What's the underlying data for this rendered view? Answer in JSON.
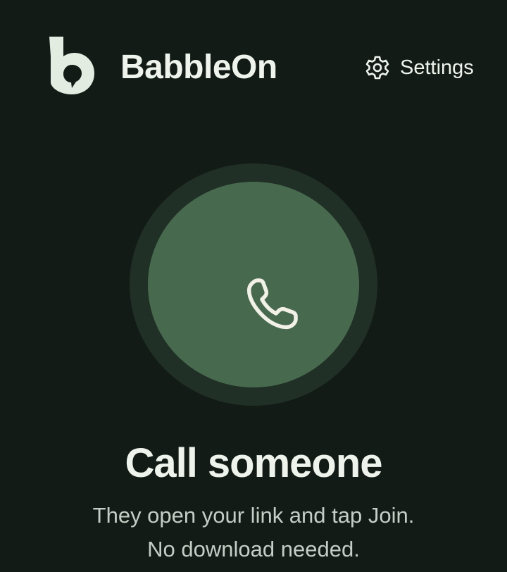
{
  "app": {
    "name": "BabbleOn",
    "logo_icon": "babbleon-b-logo"
  },
  "header": {
    "settings_label": "Settings",
    "settings_icon": "gear-icon"
  },
  "call": {
    "icon": "phone-icon",
    "title": "Call someone",
    "subtitle_line1": "They open your link and tap Join.",
    "subtitle_line2": "No download needed."
  },
  "colors": {
    "background": "#121b16",
    "ring": "#213026",
    "button": "#476a4e",
    "text": "#eef3ec",
    "muted_text": "#c5cdc6"
  }
}
